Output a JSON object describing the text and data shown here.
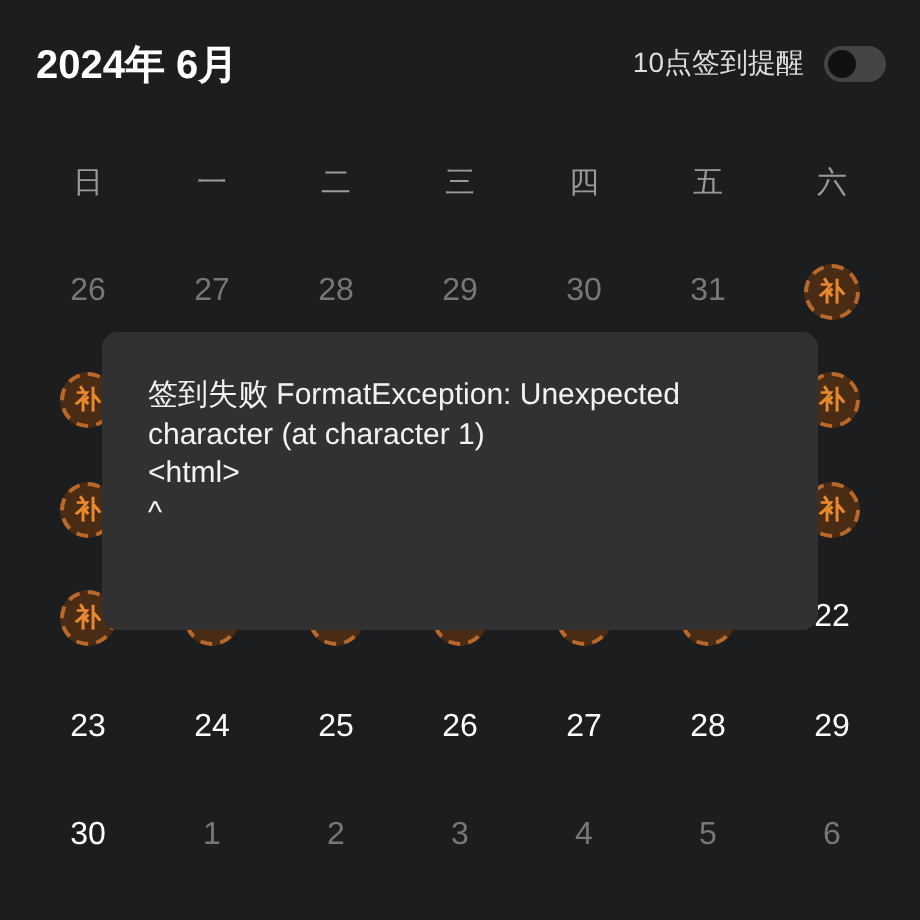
{
  "header": {
    "title": "2024年 6月",
    "reminder": {
      "label": "10点签到提醒",
      "on": false
    }
  },
  "weekdays": [
    "日",
    "一",
    "二",
    "三",
    "四",
    "五",
    "六"
  ],
  "weeks": [
    [
      {
        "kind": "other",
        "text": "26"
      },
      {
        "kind": "other",
        "text": "27"
      },
      {
        "kind": "other",
        "text": "28"
      },
      {
        "kind": "other",
        "text": "29"
      },
      {
        "kind": "other",
        "text": "30"
      },
      {
        "kind": "other",
        "text": "31"
      },
      {
        "kind": "badge",
        "text": "补"
      }
    ],
    [
      {
        "kind": "badge",
        "text": "补"
      },
      {
        "kind": "covered"
      },
      {
        "kind": "covered"
      },
      {
        "kind": "covered"
      },
      {
        "kind": "covered"
      },
      {
        "kind": "covered"
      },
      {
        "kind": "badge",
        "text": "补"
      }
    ],
    [
      {
        "kind": "badge",
        "text": "补"
      },
      {
        "kind": "covered"
      },
      {
        "kind": "covered"
      },
      {
        "kind": "covered"
      },
      {
        "kind": "covered"
      },
      {
        "kind": "covered"
      },
      {
        "kind": "badge",
        "text": "补"
      }
    ],
    [
      {
        "kind": "badge",
        "text": "补"
      },
      {
        "kind": "badge"
      },
      {
        "kind": "badge"
      },
      {
        "kind": "badge"
      },
      {
        "kind": "badge"
      },
      {
        "kind": "badge"
      },
      {
        "kind": "day",
        "text": "22"
      }
    ],
    [
      {
        "kind": "day",
        "text": "23"
      },
      {
        "kind": "day",
        "text": "24"
      },
      {
        "kind": "day",
        "text": "25"
      },
      {
        "kind": "day",
        "text": "26"
      },
      {
        "kind": "day",
        "text": "27"
      },
      {
        "kind": "day",
        "text": "28"
      },
      {
        "kind": "day",
        "text": "29"
      }
    ],
    [
      {
        "kind": "day",
        "text": "30"
      },
      {
        "kind": "other",
        "text": "1"
      },
      {
        "kind": "other",
        "text": "2"
      },
      {
        "kind": "other",
        "text": "3"
      },
      {
        "kind": "other",
        "text": "4"
      },
      {
        "kind": "other",
        "text": "5"
      },
      {
        "kind": "other",
        "text": "6"
      }
    ]
  ],
  "toast": {
    "message": "签到失败 FormatException: Unexpected character (at character 1)\n<html>\n^"
  }
}
